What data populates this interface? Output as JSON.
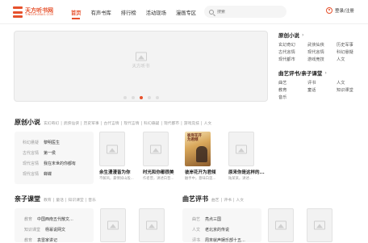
{
  "logo": {
    "cn": "天方听书网",
    "en": "TINGSHUBAO.COM"
  },
  "nav": [
    "首页",
    "有声书库",
    "排行榜",
    "活动现场",
    "漫画专区"
  ],
  "search": {
    "placeholder": "搜索"
  },
  "login": "登录/注册",
  "banner": {
    "placeholder": "天方听书",
    "dots": 5,
    "active_dot": 2
  },
  "side_original": {
    "title": "原创小说",
    "items": [
      "玄幻奇幻",
      "武侠仙侠",
      "历史军事",
      "古代言情",
      "现代言情",
      "科幻悬疑",
      "现代都市",
      "游戏竞技",
      "人文"
    ]
  },
  "side_opera": {
    "title": "曲艺评书/亲子课堂",
    "items": [
      "曲艺",
      "评书",
      "人文",
      "教育",
      "童话",
      "知识课堂",
      "音乐"
    ]
  },
  "section_original": {
    "title": "原创小说",
    "tabs": [
      "玄幻奇幻",
      "武侠仙侠",
      "历史军事",
      "古代言情",
      "现代言情",
      "科幻悬疑",
      "现代都市",
      "游戏竞技",
      "人文"
    ]
  },
  "rank_list": [
    {
      "genre": "科幻悬疑",
      "title": "黎明医生"
    },
    {
      "genre": "古代言情",
      "title": "第一侯"
    },
    {
      "genre": "现代言情",
      "title": "我在末世的你都有"
    },
    {
      "genre": "现代言情",
      "title": "蝉蝶"
    }
  ],
  "books": [
    {
      "title": "余生漫漫皆为你",
      "desc": "不解风，豪情如山般..."
    },
    {
      "title": "时光和你都很美",
      "desc": "作者曾，讲述白晋..."
    },
    {
      "title": "彼岸花开为君倾",
      "desc": "触手中，意味白莲..."
    },
    {
      "title": "原来你是这样的...",
      "desc": "陆某某，讲述..."
    }
  ],
  "featured_cover": {
    "title": "彼岸花开为君倾"
  },
  "section_kids": {
    "title": "亲子课堂",
    "tabs": [
      "教育",
      "童话",
      "知识课堂",
      "音乐"
    ]
  },
  "kids_list": [
    {
      "genre": "教育",
      "title": "中国西南五代散文..."
    },
    {
      "genre": "知识课堂",
      "title": "杨幂说网文"
    },
    {
      "genre": "教育",
      "title": "袁雷家讲记"
    }
  ],
  "section_opera": {
    "title": "曲艺评书",
    "tabs": [
      "曲艺",
      "评书",
      "人文"
    ]
  },
  "opera_list": [
    {
      "genre": "曲艺",
      "title": "亮点三国"
    },
    {
      "genre": "人文",
      "title": "老北京的传说"
    },
    {
      "genre": "评书",
      "title": "周末就声娱乐部十五..."
    }
  ]
}
